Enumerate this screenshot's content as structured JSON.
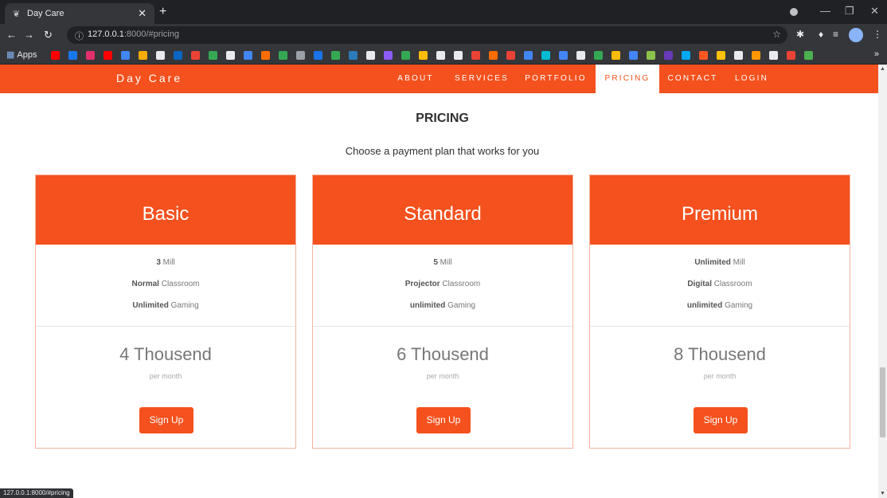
{
  "browser": {
    "tab_title": "Day Care",
    "url_host": "127.0.0.1",
    "url_rest": ":8000/#pricing",
    "bookmarks_apps_label": "Apps",
    "bookmark_colors": [
      "#ff0000",
      "#1877f2",
      "#e1306c",
      "#ff0000",
      "#4285f4",
      "#f9ab00",
      "#e8eaed",
      "#0a66c2",
      "#ea4335",
      "#34a853",
      "#e8eaed",
      "#4285f4",
      "#ff6d01",
      "#34a853",
      "#9aa0a6",
      "#1a73e8",
      "#34a853",
      "#2b7bb9",
      "#e8eaed",
      "#8b5cf6",
      "#34a853",
      "#fbbc04",
      "#e8eaed",
      "#e8eaed",
      "#ea4335",
      "#ff6d01",
      "#ea4335",
      "#4285f4",
      "#00bcd4",
      "#4285f4",
      "#e8eaed",
      "#34a853",
      "#fbbc04",
      "#4285f4",
      "#8bc34a",
      "#673ab7",
      "#03a9f4",
      "#ff5722",
      "#ffc107",
      "#e8eaed",
      "#ff9800",
      "#e8eaed",
      "#ea4335",
      "#4caf50"
    ],
    "status_url": "127.0.0.1:8000/#pricing"
  },
  "site": {
    "brand": "Day Care",
    "nav": [
      "ABOUT",
      "SERVICES",
      "PORTFOLIO",
      "PRICING",
      "CONTACT",
      "LOGIN"
    ],
    "active_nav": "PRICING",
    "accent_color": "#f4511e"
  },
  "pricing": {
    "title": "PRICING",
    "subtitle": "Choose a payment plan that works for you",
    "plans": [
      {
        "name": "Basic",
        "features": [
          {
            "bold": "3",
            "text": " Mill"
          },
          {
            "bold": "Normal",
            "text": " Classroom"
          },
          {
            "bold": "Unlimited",
            "text": " Gaming"
          }
        ],
        "price": "4 Thousend",
        "period": "per month",
        "button": "Sign Up"
      },
      {
        "name": "Standard",
        "features": [
          {
            "bold": "5",
            "text": " Mill"
          },
          {
            "bold": "Projector",
            "text": " Classroom"
          },
          {
            "bold": "unlimited",
            "text": " Gaming"
          }
        ],
        "price": "6 Thousend",
        "period": "per month",
        "button": "Sign Up"
      },
      {
        "name": "Premium",
        "features": [
          {
            "bold": "Unlimited",
            "text": " Mill"
          },
          {
            "bold": "Digital",
            "text": " Classroom"
          },
          {
            "bold": "unlimited",
            "text": " Gaming"
          }
        ],
        "price": "8 Thousend",
        "period": "per month",
        "button": "Sign Up"
      }
    ]
  }
}
